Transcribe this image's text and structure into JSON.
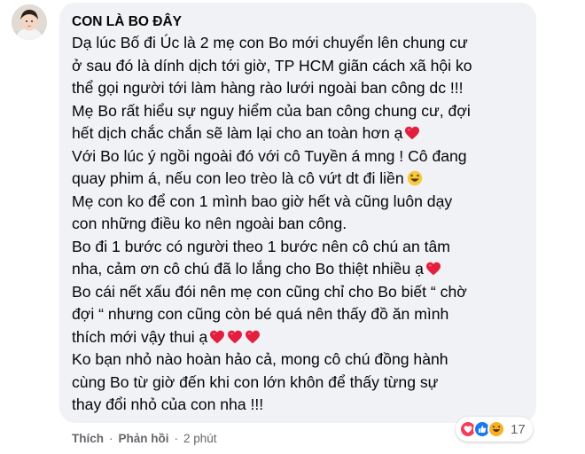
{
  "comment": {
    "author": "CON LÀ BO ĐÂY",
    "lines": [
      "Dạ lúc Bố đi Úc là 2 mẹ con Bo mới chuyển lên chung cư",
      "ở sau đó là dính dịch tới giờ, TP HCM giãn cách xã hội ko",
      "thể gọi người tới làm hàng rào lưới ngoài ban công dc !!!",
      "Mẹ Bo rất hiểu sự nguy hiểm của ban công chung cư, đợi",
      "hết dịch chắc chắn sẽ làm lại cho an toàn hơn ạ",
      "Với Bo lúc ý ngồi ngoài đó với cô Tuyền á mng ! Cô đang",
      "quay phim á, nếu con leo trèo là cô vứt dt đi liền",
      "Mẹ con ko để con 1 mình bao giờ hết và cũng luôn dạy",
      "con những điều ko nên ngoài ban công.",
      "Bo đi 1 bước có người theo 1 bước nên cô chú an tâm",
      "nha, cảm ơn cô chú đã lo lắng cho Bo thiệt nhiều ạ",
      "Bo cái nết xấu đói nên mẹ con cũng chỉ cho Bo biết “ chờ",
      "đợi “ nhưng con cũng còn bé quá nên thấy đồ ăn mình",
      "thích mới vậy thui ạ",
      "Ko bạn nhỏ nào hoàn hảo cả, mong cô chú đồng hành",
      "cùng Bo từ giờ đến khi con lớn khôn để thấy từng sự",
      "thay đổi nhỏ của con nha !!!"
    ],
    "reaction_count": "17",
    "like_label": "Thích",
    "reply_label": "Phản hồi",
    "separator": "·",
    "time_label": "2 phút"
  },
  "icons": {
    "heart_color": "#e41e3f",
    "like_color": "#1877f2",
    "haha_color": "#f7b125"
  }
}
